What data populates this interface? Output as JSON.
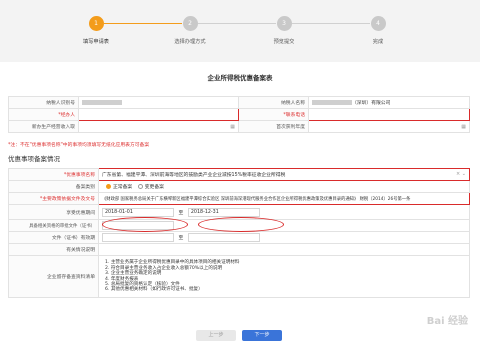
{
  "steps": [
    {
      "num": "1",
      "label": "填写申请表",
      "active": true
    },
    {
      "num": "2",
      "label": "选择办理方式",
      "active": false
    },
    {
      "num": "3",
      "label": "预览提交",
      "active": false
    },
    {
      "num": "4",
      "label": "完成",
      "active": false
    }
  ],
  "page_title": "企业所得税优惠备案表",
  "form_top": {
    "taxpayer_id_label": "纳税人识别号",
    "taxpayer_name_label": "纳税人名称",
    "taxpayer_name_suffix": "（深圳）有限公司",
    "handler_label": "*经办人",
    "phone_label": "*联系电话",
    "newcomp_label": "新办生产经营收入取",
    "first_year_label": "首次获利年度"
  },
  "note": "*注：不在\"优惠事项名称\"中的事项均须填写无纸化应用表方可备案",
  "section_title": "优惠事项备案情况",
  "form_main": {
    "item_name_label": "*优惠事项名称",
    "item_name_value": "广东省第、福建平潭、深圳前海等地区的鼓励类产业企业减按15%税率征收企业所得税",
    "type_label": "备案类别",
    "type_option1": "正常备案",
    "type_option2": "变更备案",
    "policy_label": "*主要政策依据文件及文号",
    "policy_value": "《财政部 国家税务总局关于广东横琴新区福建平潭综合实验区 深圳前海深港现代服务业合作区企业所得税优惠政策及优惠目录的通知》 财税〔2014〕26号第一条",
    "period_label": "享受优惠期间",
    "start_date": "2018-01-01",
    "to_label": "至",
    "end_date": "2018-12-31",
    "cert_label": "具备相关资格的审批文件（证书）",
    "cert_valid_label": "文件（证书）有效期",
    "to2_label": "至",
    "other_label": "有关情况说明",
    "docs_label": "企业留存备查资料清单",
    "docs_list": [
      "1. 主营业务属于企业所得税优惠目录中的具体项目的相关证明材料",
      "2. 符合目录主营业务收入占企业收入总额70%以上的说明",
      "3. 企业主营业务确定的说明",
      "4. 年度财务报表",
      "5. 总局批复的资格认定（核验）文件",
      "6. 其他优惠相关材料（如行政许可证书、批复）"
    ]
  },
  "buttons": {
    "prev": "上一步",
    "next": "下一步"
  },
  "watermark": "Bai 经验",
  "colors": {
    "accent": "#f39c1b",
    "primary": "#3a74d9",
    "error": "#d92b2b"
  }
}
